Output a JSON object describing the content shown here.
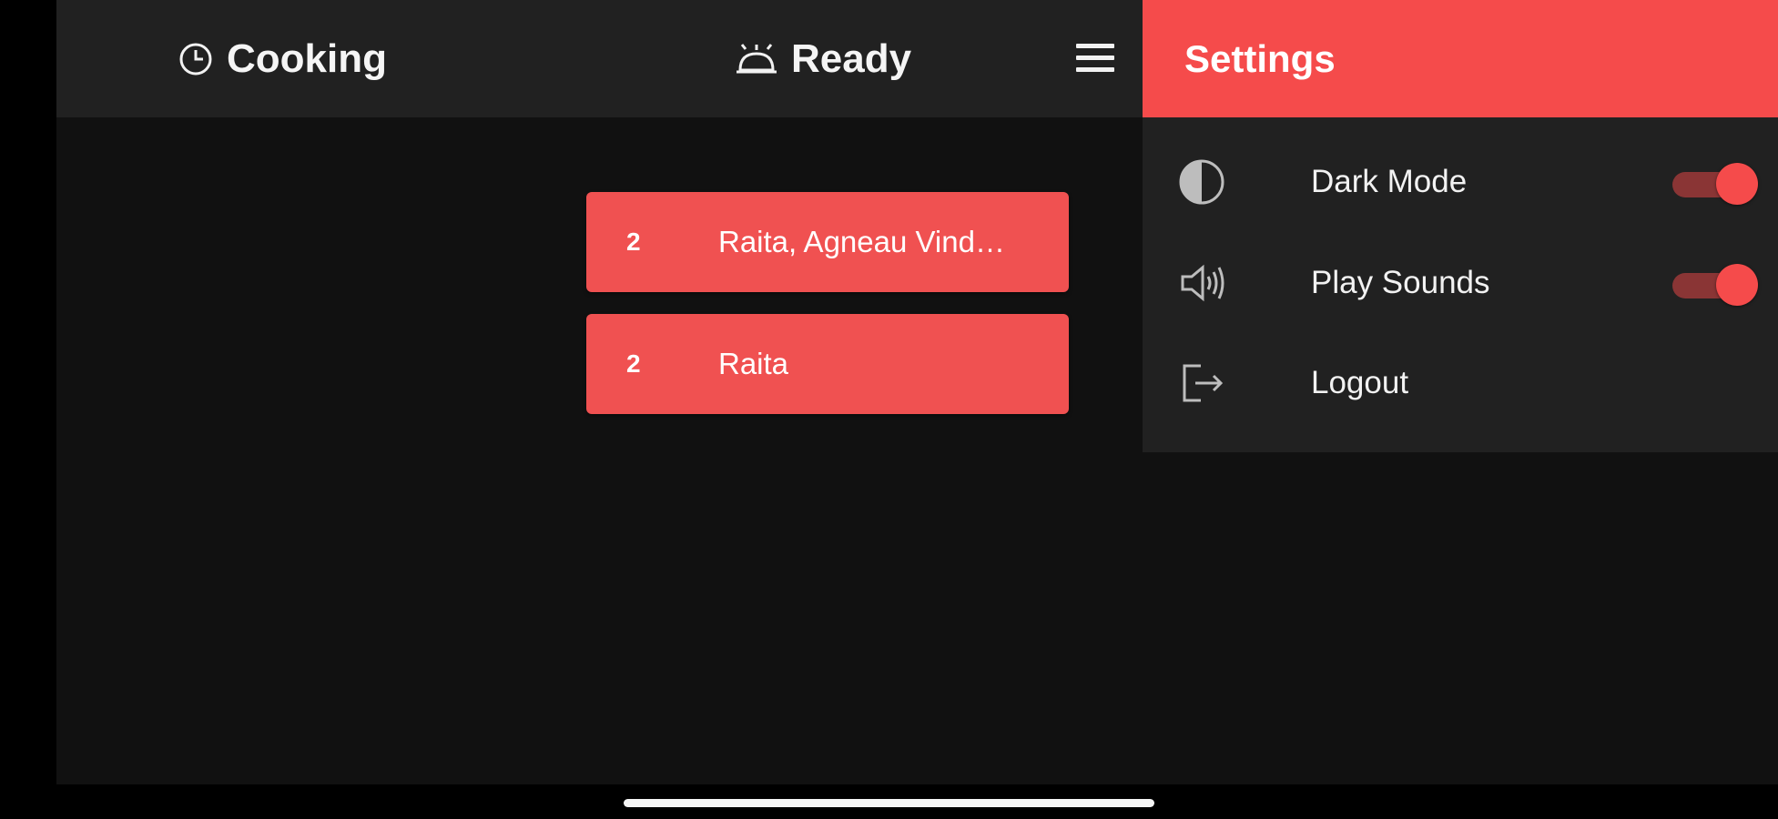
{
  "nav": {
    "tabs": [
      {
        "label": "Cooking",
        "icon": "clock-icon"
      },
      {
        "label": "Ready",
        "icon": "bell-icon"
      }
    ],
    "menu_icon": "hamburger-menu-icon"
  },
  "orders": [
    {
      "qty": "2",
      "name": "Raita, Agneau Vind…"
    },
    {
      "qty": "2",
      "name": "Raita"
    }
  ],
  "settings": {
    "title": "Settings",
    "items": [
      {
        "label": "Dark Mode",
        "icon": "contrast-icon",
        "toggle": true,
        "enabled": true
      },
      {
        "label": "Play Sounds",
        "icon": "speaker-icon",
        "toggle": true,
        "enabled": true
      },
      {
        "label": "Logout",
        "icon": "logout-icon",
        "toggle": false
      }
    ]
  },
  "colors": {
    "accent": "#f54b4b",
    "card": "#f05151",
    "background": "#111111",
    "bar": "#212121"
  }
}
